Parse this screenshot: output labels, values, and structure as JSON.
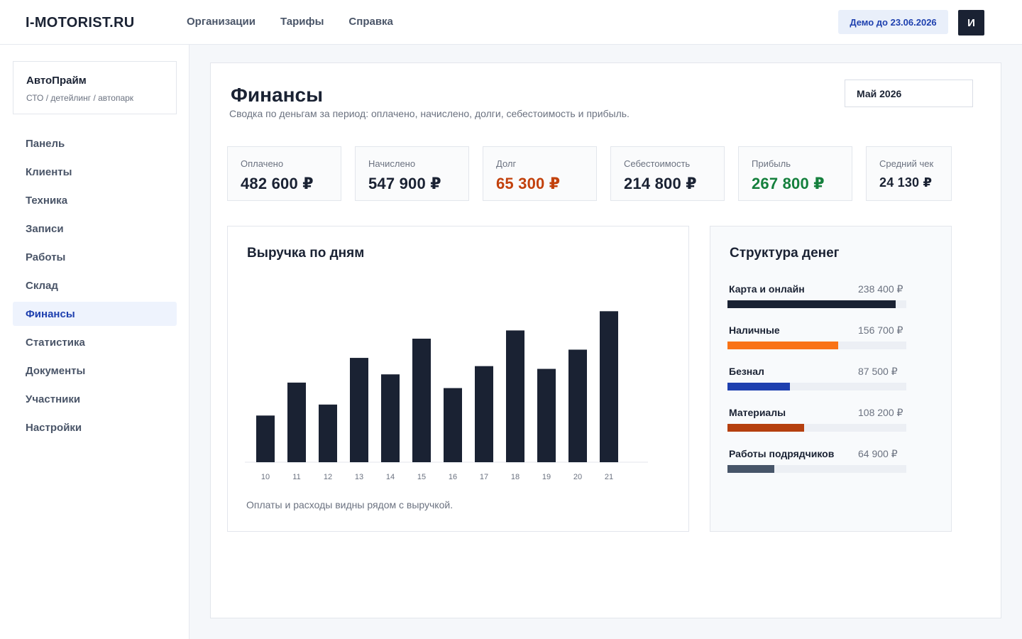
{
  "header": {
    "logo": "I-MOTORIST.RU",
    "nav": [
      "Организации",
      "Тарифы",
      "Справка"
    ],
    "demo_badge": "Демо до 23.06.2026",
    "avatar_letter": "И"
  },
  "sidebar": {
    "org_name": "АвтоПрайм",
    "org_subtitle": "СТО / детейлинг / автопарк",
    "items": [
      {
        "label": "Панель"
      },
      {
        "label": "Клиенты"
      },
      {
        "label": "Техника"
      },
      {
        "label": "Записи"
      },
      {
        "label": "Работы"
      },
      {
        "label": "Склад"
      },
      {
        "label": "Финансы",
        "active": true
      },
      {
        "label": "Статистика"
      },
      {
        "label": "Документы"
      },
      {
        "label": "Участники"
      },
      {
        "label": "Настройки"
      }
    ]
  },
  "main": {
    "title": "Финансы",
    "subtitle": "Сводка по деньгам за период: оплачено, начислено, долги, себестоимость и прибыль.",
    "period": "Май 2026",
    "kpis": [
      {
        "label": "Оплачено",
        "value": "482 600 ₽"
      },
      {
        "label": "Начислено",
        "value": "547 900 ₽"
      },
      {
        "label": "Долг",
        "value": "65 300 ₽",
        "color": "#c2410c"
      },
      {
        "label": "Себестоимость",
        "value": "214 800 ₽"
      },
      {
        "label": "Прибыль",
        "value": "267 800 ₽",
        "color": "#15803d"
      },
      {
        "label": "Средний чек",
        "value": "24 130 ₽"
      }
    ],
    "revenue_card": {
      "title": "Выручка по дням",
      "note": "Оплаты и расходы видны рядом с выручкой."
    },
    "structure_card": {
      "title": "Структура денег",
      "items": [
        {
          "label": "Карта и онлайн",
          "value": "238 400 ₽",
          "share": 0.94,
          "color": "#1a2233"
        },
        {
          "label": "Наличные",
          "value": "156 700 ₽",
          "share": 0.62,
          "color": "#f97316"
        },
        {
          "label": "Безнал",
          "value": "87 500 ₽",
          "share": 0.35,
          "color": "#1e40af"
        },
        {
          "label": "Материалы",
          "value": "108 200 ₽",
          "share": 0.43,
          "color": "#b5400f"
        },
        {
          "label": "Работы подрядчиков",
          "value": "64 900 ₽",
          "share": 0.26,
          "color": "#475569"
        }
      ]
    }
  },
  "chart_data": {
    "type": "bar",
    "title": "Выручка по дням",
    "categories": [
      "10",
      "11",
      "12",
      "13",
      "14",
      "15",
      "16",
      "17",
      "18",
      "19",
      "20",
      "21"
    ],
    "values": [
      17,
      29,
      21,
      38,
      32,
      45,
      27,
      35,
      48,
      34,
      41,
      55
    ],
    "ylim": [
      0,
      60
    ],
    "grid": false,
    "color": "#1a2233"
  }
}
